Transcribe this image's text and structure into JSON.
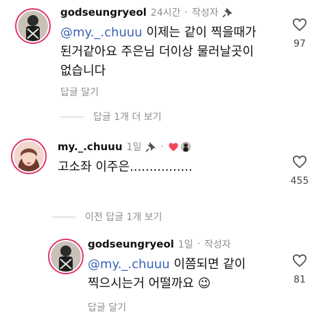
{
  "comments": [
    {
      "username": "godseungryeol",
      "time": "24시간",
      "dot": "·",
      "author_label": "작성자",
      "mention": "@my._.chuuu",
      "text_line1": " 이제는 같이 찍을때가",
      "text_line2": "된거같아요 주은님 더이상 물러날곳이",
      "text_line3": "없습니다",
      "reply_label": "답글 달기",
      "like_count": "97"
    },
    {
      "username": "my._.chuuu",
      "time": "1일",
      "text": "고소좌 이주은................",
      "like_count": "455"
    },
    {
      "username": "godseungryeol",
      "time": "1일",
      "dot": "·",
      "author_label": "작성자",
      "mention": "@my._.chuuu",
      "text_line1": " 이쯤되면 같이",
      "text_line2": "찍으시는거 어떨까요",
      "emoji": "😉",
      "reply_label": "답글 달기",
      "like_count": "81"
    }
  ],
  "view_replies_label": "답글 1개 더 보기",
  "prev_replies_label": "이전 답글 1개 보기",
  "colors": {
    "mention": "#3b62b5",
    "story_ring": "#e2336b",
    "heart_red": "#ed4956"
  }
}
